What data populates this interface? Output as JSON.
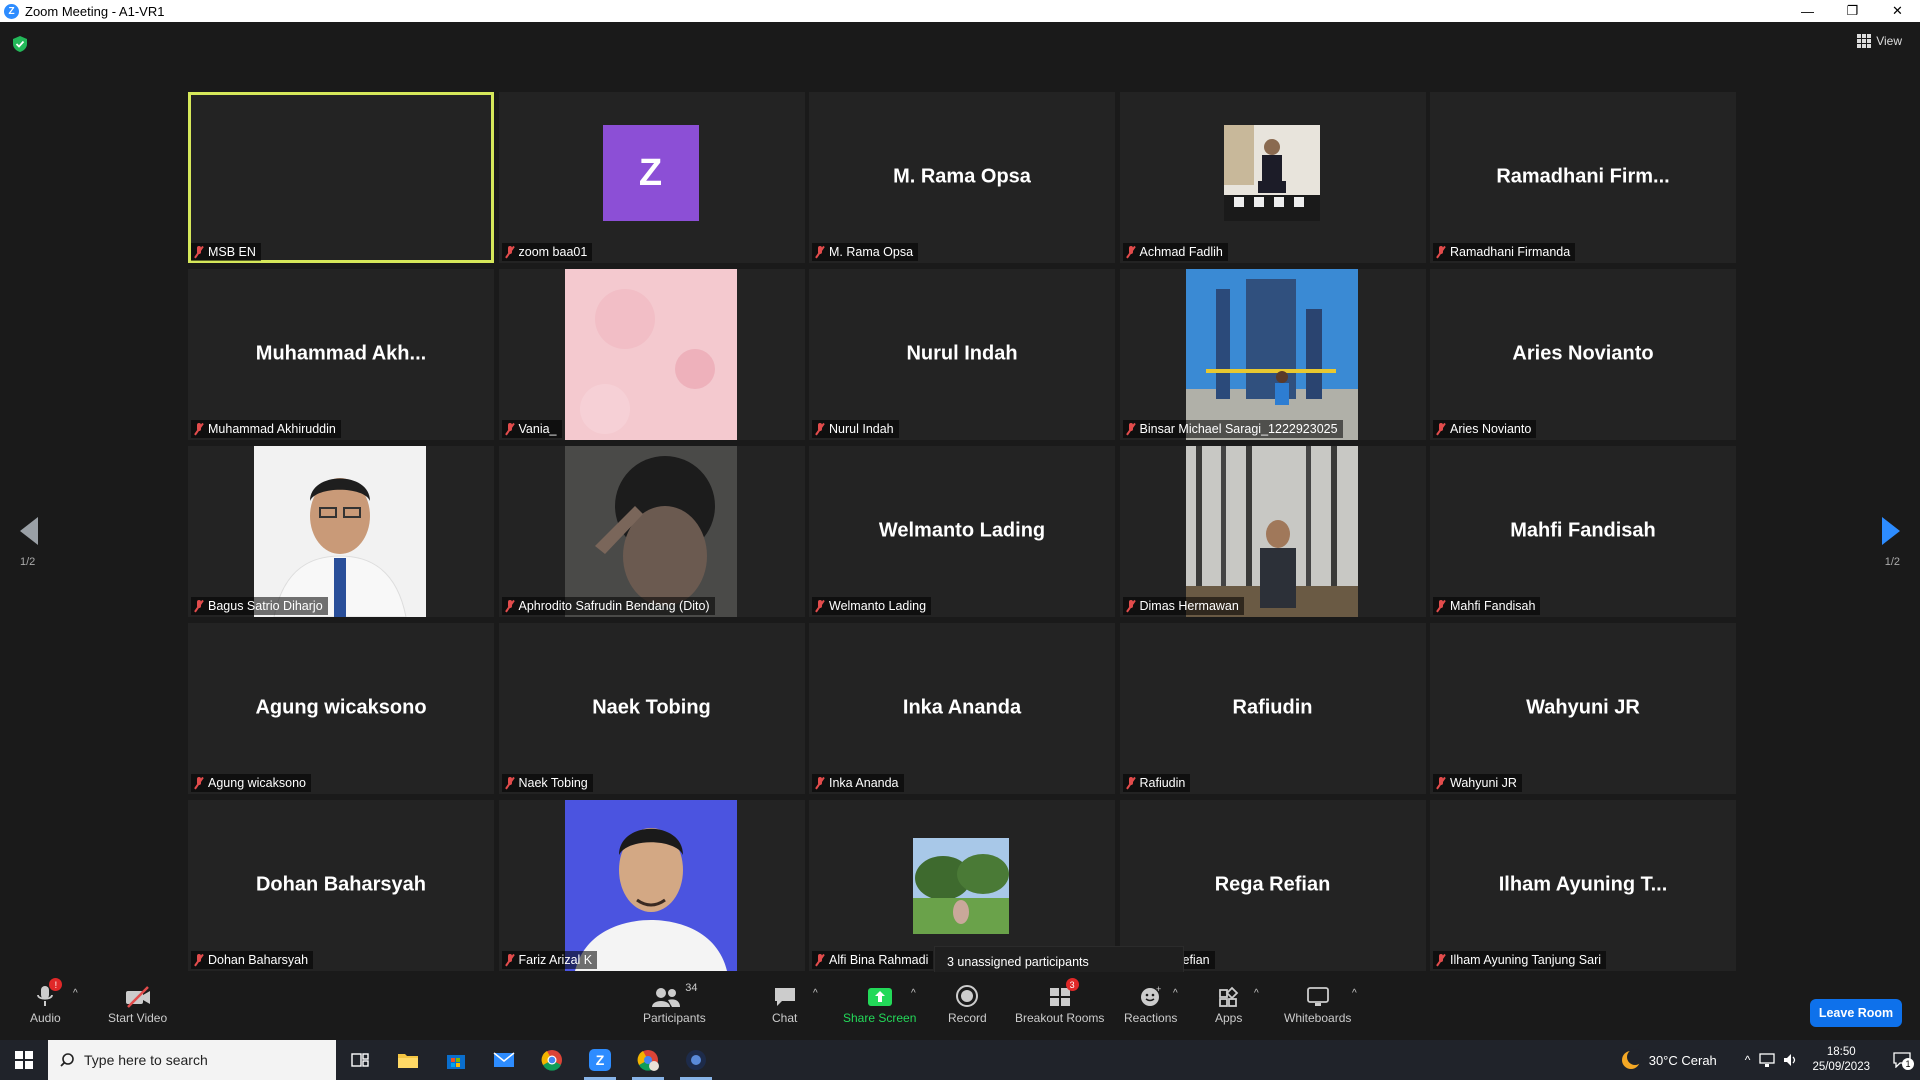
{
  "window": {
    "title": "Zoom Meeting - A1-VR1",
    "logo_letter": "Z",
    "controls": [
      "—",
      "❐",
      "✕"
    ]
  },
  "view_button": "View",
  "pagination": {
    "left": "1/2",
    "right": "1/2"
  },
  "tiles": [
    {
      "label": "MSB EN",
      "big": "",
      "active": true
    },
    {
      "label": "zoom baa01",
      "big": "",
      "avatar": "Z"
    },
    {
      "label": "M. Rama Opsa",
      "big": "M. Rama Opsa"
    },
    {
      "label": "Achmad Fadlih",
      "big": ""
    },
    {
      "label": "Ramadhani Firmanda",
      "big": "Ramadhani  Firm..."
    },
    {
      "label": "Muhammad Akhiruddin",
      "big": "Muhammad  Akh..."
    },
    {
      "label": "Vania_",
      "big": ""
    },
    {
      "label": "Nurul Indah",
      "big": "Nurul Indah"
    },
    {
      "label": "Binsar Michael Saragi_1222923025",
      "big": ""
    },
    {
      "label": "Aries Novianto",
      "big": "Aries Novianto"
    },
    {
      "label": "Bagus Satrio Diharjo",
      "big": ""
    },
    {
      "label": "Aphrodito Safrudin Bendang (Dito)",
      "big": ""
    },
    {
      "label": "Welmanto Lading",
      "big": "Welmanto Lading"
    },
    {
      "label": "Dimas Hermawan",
      "big": ""
    },
    {
      "label": "Mahfi Fandisah",
      "big": "Mahfi Fandisah"
    },
    {
      "label": "Agung wicaksono",
      "big": "Agung wicaksono"
    },
    {
      "label": "Naek Tobing",
      "big": "Naek Tobing"
    },
    {
      "label": "Inka Ananda",
      "big": "Inka Ananda"
    },
    {
      "label": "Rafiudin",
      "big": "Rafiudin"
    },
    {
      "label": "Wahyuni JR",
      "big": "Wahyuni JR"
    },
    {
      "label": "Dohan Baharsyah",
      "big": "Dohan Baharsyah"
    },
    {
      "label": "Fariz Arizal K",
      "big": ""
    },
    {
      "label": "Alfi Bina Rahmadi",
      "big": ""
    },
    {
      "label": "efian",
      "big": "Rega Refian"
    },
    {
      "label": "Ilham Ayuning Tanjung Sari",
      "big": "Ilham Ayuning T..."
    }
  ],
  "tooltip": "3 unassigned participants",
  "toolbar": {
    "audio": "Audio",
    "audio_badge": "!",
    "start_video": "Start Video",
    "participants": "Participants",
    "participants_count": "34",
    "chat": "Chat",
    "share_screen": "Share Screen",
    "record": "Record",
    "breakout_rooms": "Breakout Rooms",
    "breakout_badge": "3",
    "reactions": "Reactions",
    "apps": "Apps",
    "whiteboards": "Whiteboards",
    "leave": "Leave Room"
  },
  "taskbar": {
    "search_placeholder": "Type here to search",
    "weather": "30°C  Cerah",
    "time": "18:50",
    "date": "25/09/2023",
    "notification_count": "1"
  },
  "colors": {
    "accent_blue": "#2d8cff",
    "active_speaker": "#d6e85a",
    "share_green": "#23d959",
    "mute_red": "#e24c4c"
  }
}
